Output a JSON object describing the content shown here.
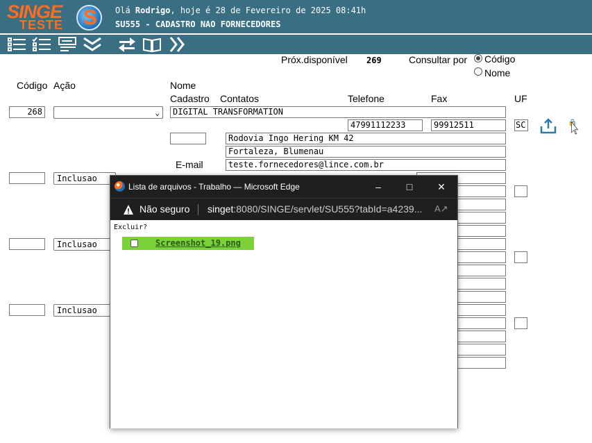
{
  "header": {
    "logo_top": "SINGE",
    "logo_bottom": "TESTE",
    "logo_letter": "S",
    "greeting_prefix": "Olá ",
    "user": "Rodrigo",
    "greeting_suffix": ", hoje é 28 de Fevereiro de 2025 08:41h",
    "screen_title": "SU555 - CADASTRO NAO FORNECEDORES"
  },
  "toolbar": {
    "icons": [
      "list-icon",
      "checklist-icon",
      "card-icon",
      "double-chevron-down-icon",
      "refresh-icon",
      "book-icon",
      "double-chevron-right-icon"
    ]
  },
  "form": {
    "prox_label": "Próx.disponível",
    "prox_value": "269",
    "consultar_label": "Consultar por",
    "radio_codigo": "Código",
    "radio_nome": "Nome",
    "col_codigo": "Código",
    "col_acao": "Ação",
    "col_nome": "Nome",
    "col_cadastro": "Cadastro",
    "col_contatos": "Contatos",
    "col_telefone": "Telefone",
    "col_fax": "Fax",
    "col_uf": "UF",
    "email_label": "E-mail",
    "record": {
      "codigo": "268",
      "nome": "DIGITAL TRANSFORMATION",
      "telefone": "47991112233",
      "fax": "99912511",
      "uf": "SC",
      "endereco": "Rodovia Ingo Hering KM 42",
      "bairro": "Fortaleza, Blumenau",
      "email": "teste.fornecedores@lince.com.br"
    },
    "new_action": "Inclusao"
  },
  "popup": {
    "title": "Lista de arquivos - Trabalho — Microsoft Edge",
    "not_secure": "Não seguro",
    "url_host": "singet",
    "url_rest": ":8080/SINGE/servlet/SU555?tabId=a4239...",
    "excluir": "Excluir?",
    "file": "Screenshot_19.png"
  }
}
